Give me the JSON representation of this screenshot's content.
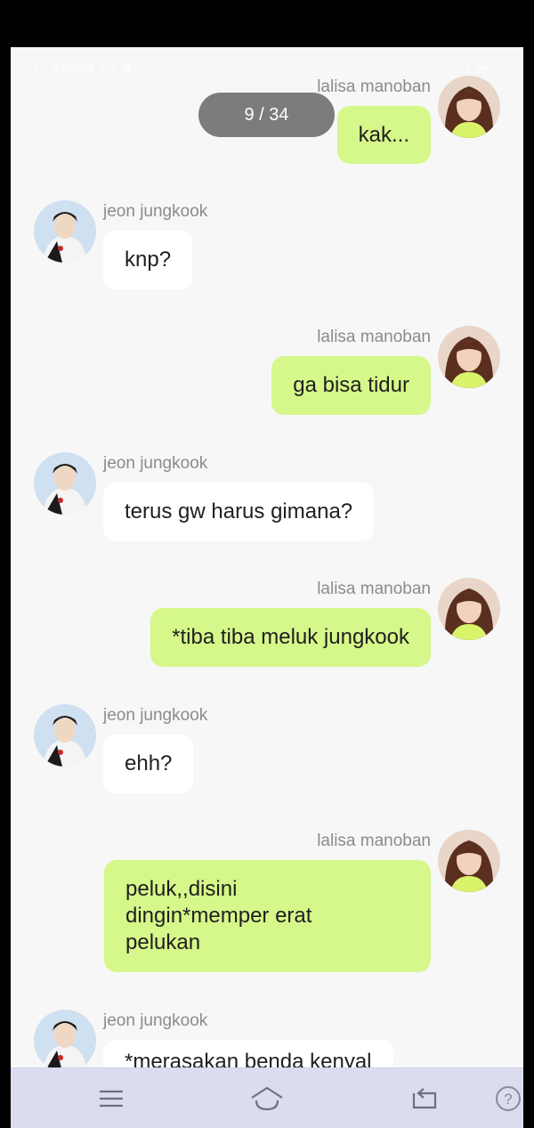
{
  "status_bar": {
    "left_text": "•• 12:03 • • ■",
    "right_text": "•• •• •"
  },
  "page_indicator": "9 / 34",
  "colors": {
    "screen_bg": "#f7f7f7",
    "outgoing_bubble": "#d6f78a",
    "incoming_bubble": "#ffffff",
    "nav_bar": "#dcdcf0"
  },
  "messages": [
    {
      "side": "right",
      "sender": "lalisa manoban",
      "text": "kak..."
    },
    {
      "side": "left",
      "sender": "jeon jungkook",
      "text": "knp?"
    },
    {
      "side": "right",
      "sender": "lalisa manoban",
      "text": "ga bisa tidur"
    },
    {
      "side": "left",
      "sender": "jeon jungkook",
      "text": "terus gw harus gimana?"
    },
    {
      "side": "right",
      "sender": "lalisa manoban",
      "text": "*tiba tiba meluk jungkook"
    },
    {
      "side": "left",
      "sender": "jeon jungkook",
      "text": "ehh?"
    },
    {
      "side": "right",
      "sender": "lalisa manoban",
      "text": "peluk,,disini\ndingin*memper erat\npelukan"
    },
    {
      "side": "left",
      "sender": "jeon jungkook",
      "text": "*merasakan benda kenyal"
    }
  ],
  "nav": {
    "menu_icon": "hamburger-menu-icon",
    "home_icon": "home-icon",
    "back_icon": "back-icon",
    "help_icon": "help-icon"
  }
}
